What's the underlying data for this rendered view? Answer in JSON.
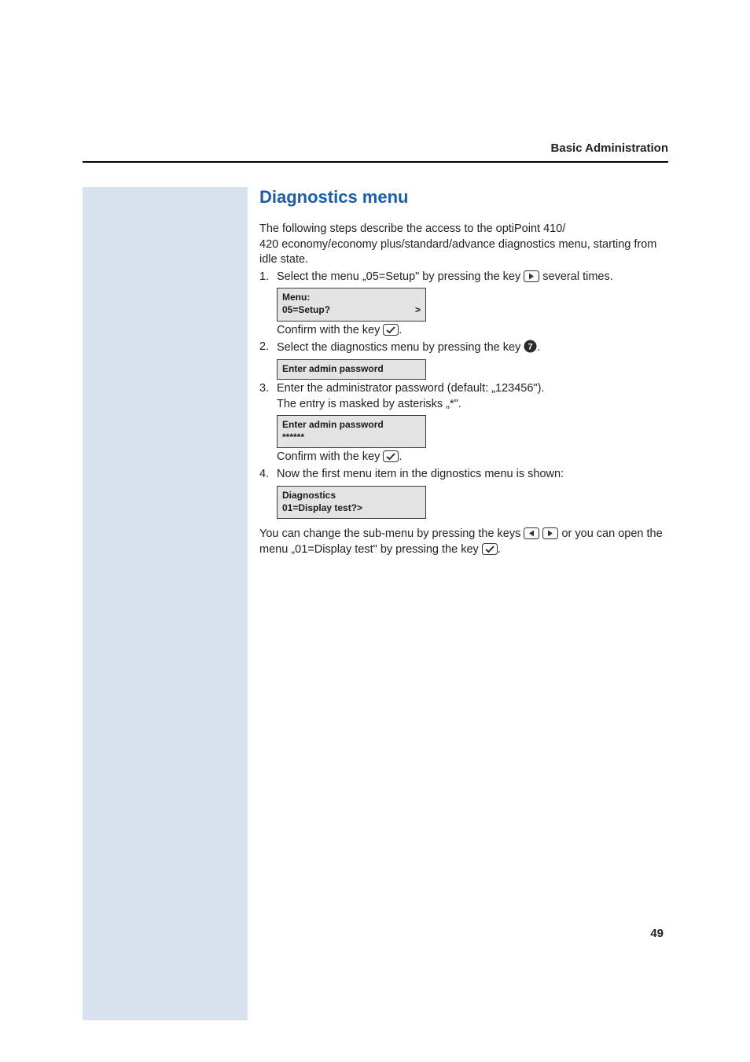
{
  "header": {
    "title": "Basic Administration"
  },
  "section": {
    "title": "Diagnostics menu"
  },
  "intro": {
    "line1": "The following steps describe the access to the optiPoint 410/",
    "line2": "420 economy/economy plus/standard/advance diagnostics menu, starting from idle state."
  },
  "steps": {
    "s1": {
      "num": "1.",
      "pre": "Select the menu „05=Setup\" by pressing the key ",
      "post": " several times."
    },
    "box1": {
      "l1": "Menu:",
      "l2": "05=Setup?",
      "arrow": ">"
    },
    "confirm1": {
      "pre": "Confirm with the key ",
      "post": "."
    },
    "s2": {
      "num": "2.",
      "pre": "Select the diagnostics menu by pressing the key ",
      "post": "."
    },
    "box2": {
      "l1": "Enter admin password",
      "l2": ""
    },
    "s3": {
      "num": "3.",
      "l1": "Enter the administrator password (default: „123456\").",
      "l2": "The entry is masked by asterisks „*\"."
    },
    "box3": {
      "l1": "Enter admin password",
      "l2": "******"
    },
    "confirm3": {
      "pre": "Confirm with the key ",
      "post": "."
    },
    "s4": {
      "num": "4.",
      "text": "Now the first menu item in the dignostics menu is shown:"
    },
    "box4": {
      "l1": "Diagnostics",
      "l2": "01=Display test?>"
    }
  },
  "closing": {
    "pre": "You can change the sub-menu by pressing the keys ",
    "mid": " or you can open the menu „01=Display test\" by pressing the key ",
    "post": "."
  },
  "pagenum": "49"
}
